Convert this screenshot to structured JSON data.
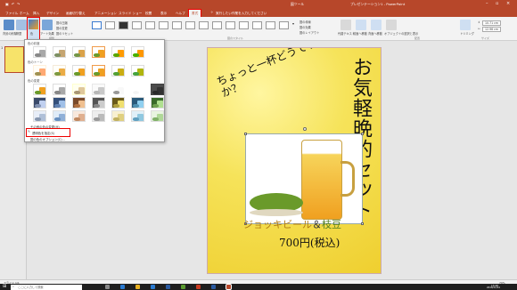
{
  "window": {
    "title": "プレゼンテーション1 - PowerPoint",
    "context_tab": "図ツール"
  },
  "ribbon_tabs": [
    "ファイル",
    "ホーム",
    "挿入",
    "デザイン",
    "画面切り替え",
    "アニメーション",
    "スライド ショー",
    "校閲",
    "表示",
    "ヘルプ",
    "書式"
  ],
  "active_tab": "書式",
  "tell_me": "実行したい作業を入力してください",
  "ribbon": {
    "group_adjust": "調整",
    "group_styles": "図のスタイル",
    "group_arrange": "配置",
    "group_size": "サイズ",
    "remove_bg": "背景の削除",
    "corrections": "修整",
    "color": "色",
    "art_effects": "アート効果",
    "compress": "図の圧縮",
    "change": "図の変更",
    "reset": "図のリセット",
    "border": "図の枠線",
    "effects": "図の効果",
    "layout": "図のレイアウト",
    "alt_text": "代替テキスト",
    "bring_forward": "前面へ移動",
    "send_backward": "背面へ移動",
    "selection_pane": "オブジェクトの選択と表示",
    "crop": "トリミング",
    "height": "10.71 cm",
    "width": "12.96 cm"
  },
  "dropdown": {
    "header_saturation": "色の彩度",
    "header_tone": "色のトーン",
    "header_recolor": "色の変更",
    "item_more": "その他の色の変更(M)",
    "item_transparent": "透明色を指定(S)",
    "item_options": "図の色のオプション(C)..."
  },
  "slide": {
    "title_vertical": "お気軽晩酌セット",
    "callout": "ちょっと一杯どうですか？",
    "item_line": "ジョッキビール＆枝豆",
    "item_beer": "ジョッキビール",
    "item_amp": "＆",
    "item_edamame": "枝豆",
    "price": "700円(税込)"
  },
  "status": {
    "slide_counter": "スライド 1/1",
    "zoom": "79%"
  },
  "taskbar": {
    "search_placeholder": "ここに入力して検索",
    "time": "13:46",
    "date": "2018/11/14"
  },
  "colors": {
    "accent": "#b7472a",
    "highlight": "#e00000",
    "beer": "#f0a020",
    "edamame": "#6a9a2a"
  }
}
